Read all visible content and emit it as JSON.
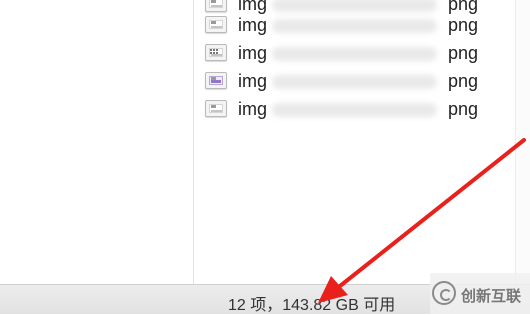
{
  "files": [
    {
      "name_start": "img",
      "ext": "png",
      "icon": "screenshot-thumbnail-icon"
    },
    {
      "name_start": "img",
      "ext": "png",
      "icon": "screenshot-thumbnail-icon"
    },
    {
      "name_start": "img",
      "ext": "png",
      "icon": "screenshot-thumbnail-icon"
    },
    {
      "name_start": "img",
      "ext": "png",
      "icon": "screenshot-thumbnail-icon"
    },
    {
      "name_start": "img",
      "ext": "png",
      "icon": "screenshot-thumbnail-icon"
    }
  ],
  "status_bar": {
    "text": "12 项，143.82 GB 可用"
  },
  "watermark": {
    "text": "创新互联",
    "icon": "brand-logo-icon"
  },
  "annotation": {
    "icon": "red-arrow-icon",
    "color": "#e8211c"
  }
}
